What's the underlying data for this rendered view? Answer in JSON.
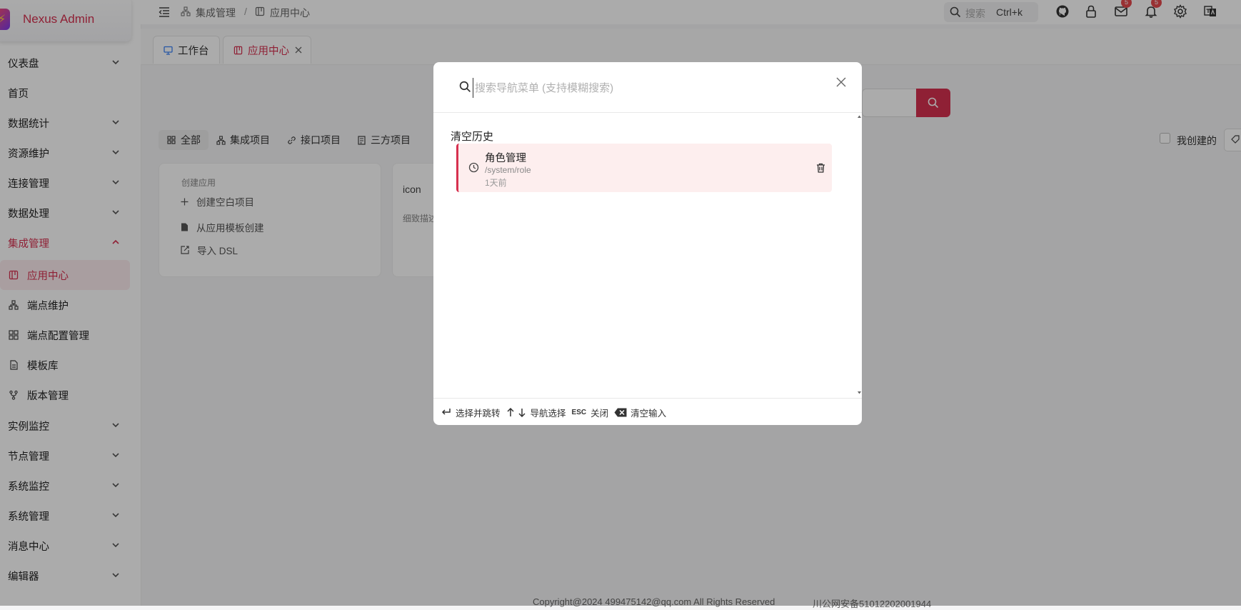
{
  "app": {
    "name": "Nexus Admin"
  },
  "sidebar": {
    "items": [
      {
        "label": "仪表盘",
        "expandable": true
      },
      {
        "label": "首页",
        "expandable": false
      },
      {
        "label": "数据统计",
        "expandable": true
      },
      {
        "label": "资源维护",
        "expandable": true
      },
      {
        "label": "连接管理",
        "expandable": true
      },
      {
        "label": "数据处理",
        "expandable": true
      },
      {
        "label": "集成管理",
        "expandable": true,
        "expanded": true
      },
      {
        "label": "应用中心",
        "child": true,
        "active": true,
        "icon": "app-center-icon"
      },
      {
        "label": "端点维护",
        "child": true,
        "icon": "endpoint-icon"
      },
      {
        "label": "端点配置管理",
        "child": true,
        "icon": "endpoint-config-icon"
      },
      {
        "label": "模板库",
        "child": true,
        "icon": "template-icon"
      },
      {
        "label": "版本管理",
        "child": true,
        "icon": "branch-icon"
      },
      {
        "label": "实例监控",
        "expandable": true
      },
      {
        "label": "节点管理",
        "expandable": true
      },
      {
        "label": "系统监控",
        "expandable": true
      },
      {
        "label": "系统管理",
        "expandable": true
      },
      {
        "label": "消息中心",
        "expandable": true
      },
      {
        "label": "编辑器",
        "expandable": true
      }
    ]
  },
  "header": {
    "breadcrumb": [
      "集成管理",
      "应用中心"
    ],
    "search_placeholder": "搜索",
    "search_shortcut": "Ctrl+k",
    "mail_badge": "5",
    "notify_badge": "5"
  },
  "tabs": [
    {
      "label": "工作台",
      "active": false
    },
    {
      "label": "应用中心",
      "active": true
    }
  ],
  "filters": {
    "items": [
      "全部",
      "集成项目",
      "接口项目",
      "三方项目"
    ],
    "mine_label": "我创建的"
  },
  "create_card": {
    "title": "创建应用",
    "actions": [
      "创建空白项目",
      "从应用模板创建",
      "导入 DSL"
    ]
  },
  "partial_card": {
    "icon_text": "icon",
    "desc_text": "细致描述"
  },
  "footer_text": "Copyright@2024 499475142@qq.com All Rights Reserved",
  "footer_police": "川公网安备51012202001944",
  "modal": {
    "placeholder": "搜索导航菜单 (支持模糊搜索)",
    "value": "",
    "history_title": "清空历史",
    "history": [
      {
        "title": "角色管理",
        "path": "/system/role",
        "time": "1天前"
      }
    ],
    "footer_hints": [
      {
        "key": "↵",
        "label": "选择并跳转"
      },
      {
        "key": "↑↓",
        "label": "导航选择"
      },
      {
        "key": "ESC",
        "label": "关闭"
      },
      {
        "key": "⌫",
        "label": "清空输入"
      }
    ]
  },
  "colors": {
    "accent": "#d6304f",
    "overlay": "rgba(0,0,0,0.33)"
  }
}
